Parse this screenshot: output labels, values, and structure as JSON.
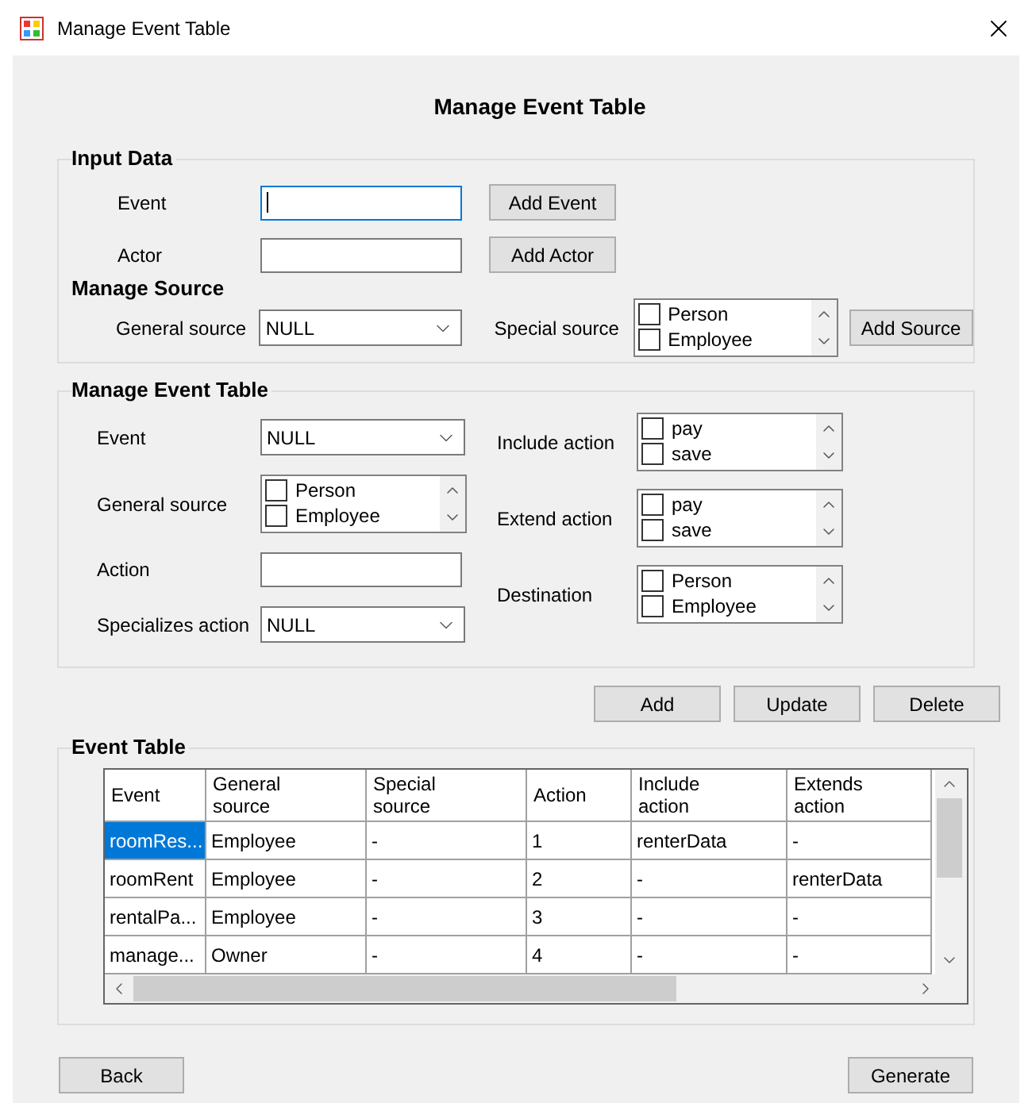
{
  "window": {
    "title": "Manage Event Table"
  },
  "heading": "Manage Event Table",
  "input_data": {
    "title": "Input Data",
    "fields": [
      {
        "label": "Event",
        "focused": true,
        "button": "Add Event"
      },
      {
        "label": "Actor",
        "focused": false,
        "button": "Add Actor"
      }
    ]
  },
  "manage_source": {
    "title": "Manage Source",
    "general_source": {
      "label": "General source",
      "value": "NULL"
    },
    "special_source": {
      "label": "Special source",
      "items": [
        {
          "label": "Person",
          "checked": false
        },
        {
          "label": "Employee",
          "checked": false
        }
      ]
    },
    "button": "Add Source"
  },
  "manage_event_table": {
    "title": "Manage Event Table",
    "left": [
      {
        "kind": "select",
        "label": "Event",
        "value": "NULL"
      },
      {
        "kind": "checklist",
        "label": "General source",
        "items": [
          {
            "label": "Person",
            "checked": false
          },
          {
            "label": "Employee",
            "checked": false
          }
        ]
      },
      {
        "kind": "text",
        "label": "Action"
      },
      {
        "kind": "select",
        "label": "Specializes action",
        "value": "NULL"
      }
    ],
    "right": [
      {
        "kind": "checklist",
        "label": "Include action",
        "items": [
          {
            "label": "pay",
            "checked": false
          },
          {
            "label": "save",
            "checked": false
          }
        ]
      },
      {
        "kind": "checklist",
        "label": "Extend action",
        "items": [
          {
            "label": "pay",
            "checked": false
          },
          {
            "label": "save",
            "checked": false
          }
        ]
      },
      {
        "kind": "checklist",
        "label": "Destination",
        "items": [
          {
            "label": "Person",
            "checked": false
          },
          {
            "label": "Employee",
            "checked": false
          }
        ]
      }
    ]
  },
  "actions": [
    "Add",
    "Update",
    "Delete"
  ],
  "event_table": {
    "title": "Event Table",
    "columns": [
      "Event",
      "General source",
      "Special source",
      "Action",
      "Include action",
      "Extends action"
    ],
    "rows": [
      {
        "selected": true,
        "cells": [
          "roomRes...",
          "Employee",
          "-",
          "1",
          "renterData",
          "-"
        ]
      },
      {
        "selected": false,
        "cells": [
          "roomRent",
          "Employee",
          "-",
          "2",
          "-",
          "renterData"
        ]
      },
      {
        "selected": false,
        "cells": [
          "rentalPa...",
          "Employee",
          "-",
          "3",
          "-",
          "-"
        ]
      },
      {
        "selected": false,
        "cells": [
          "manage...",
          "Owner",
          "-",
          "4",
          "-",
          "-"
        ]
      }
    ]
  },
  "footer_buttons": [
    "Back",
    "Generate"
  ]
}
